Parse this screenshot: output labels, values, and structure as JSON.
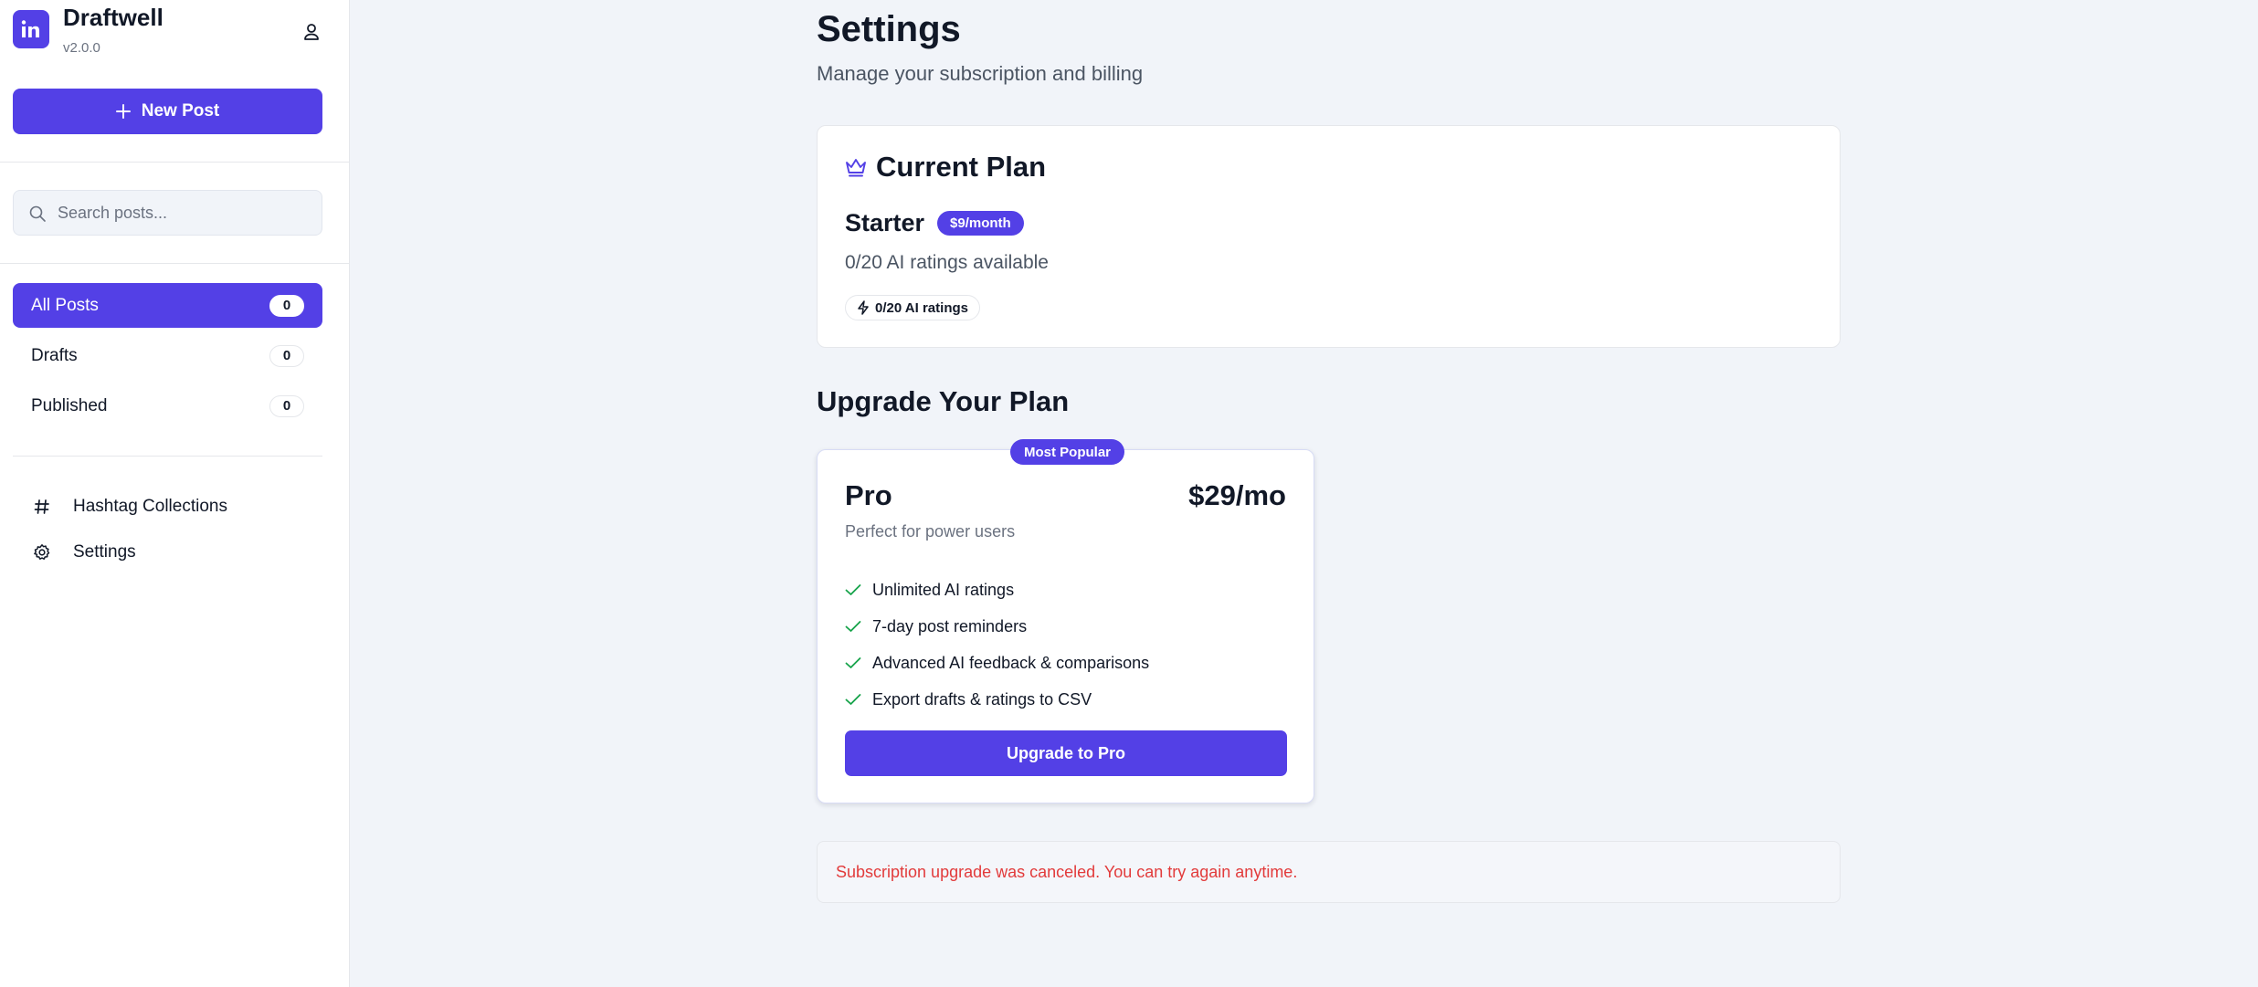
{
  "app": {
    "name": "Draftwell",
    "version": "v2.0.0"
  },
  "sidebar": {
    "new_post_label": "New Post",
    "search_placeholder": "Search posts...",
    "nav": [
      {
        "label": "All Posts",
        "count": "0",
        "active": true
      },
      {
        "label": "Drafts",
        "count": "0",
        "active": false
      },
      {
        "label": "Published",
        "count": "0",
        "active": false
      }
    ],
    "links": [
      {
        "label": "Hashtag Collections",
        "icon": "hash-icon"
      },
      {
        "label": "Settings",
        "icon": "gear-icon"
      }
    ]
  },
  "page": {
    "title": "Settings",
    "subtitle": "Manage your subscription and billing"
  },
  "current_plan": {
    "heading": "Current Plan",
    "icon": "crown-icon",
    "plan_name": "Starter",
    "price": "$9/month",
    "availability": "0/20 AI ratings available",
    "ratings_chip": "0/20 AI ratings"
  },
  "upgrade": {
    "heading": "Upgrade Your Plan",
    "pro": {
      "badge": "Most Popular",
      "name": "Pro",
      "price": "$29/mo",
      "description": "Perfect for power users",
      "features": [
        "Unlimited AI ratings",
        "7-day post reminders",
        "Advanced AI feedback & comparisons",
        "Export drafts & ratings to CSV"
      ],
      "button_label": "Upgrade to Pro"
    }
  },
  "alert": {
    "message": "Subscription upgrade was canceled. You can try again anytime."
  },
  "colors": {
    "accent": "#5340e6",
    "error": "#e23b3b",
    "success": "#16a34a",
    "background": "#f1f4f9"
  }
}
